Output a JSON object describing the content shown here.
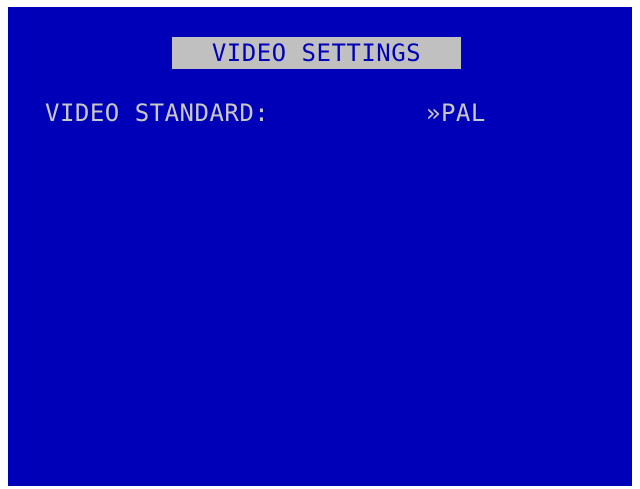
{
  "menu": {
    "title": "VIDEO SETTINGS",
    "items": [
      {
        "label": "VIDEO STANDARD:",
        "value": "»PAL"
      }
    ]
  },
  "colors": {
    "background": "#0000b8",
    "title_bar": "#c0c0c0",
    "text": "#c8c8c8"
  }
}
